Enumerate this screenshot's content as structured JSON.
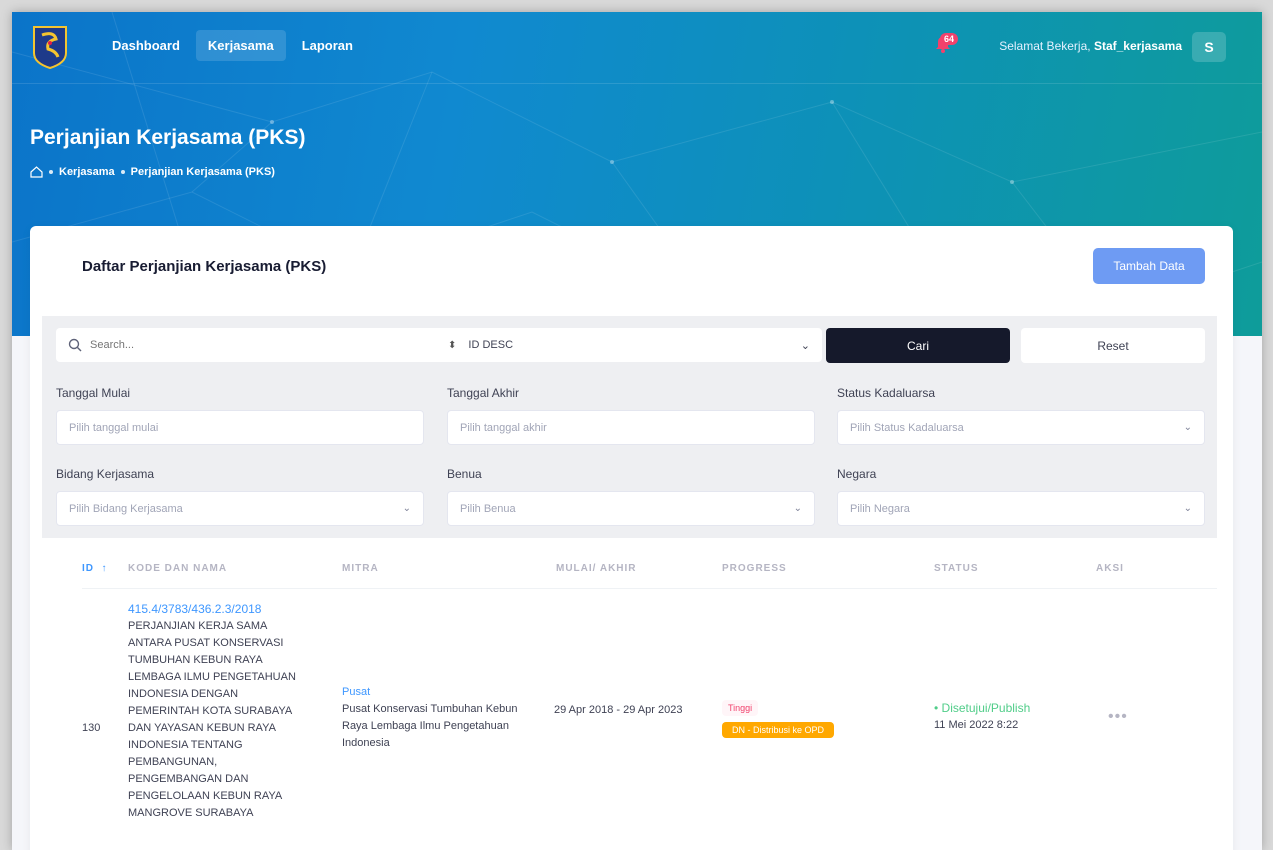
{
  "nav": {
    "items": [
      "Dashboard",
      "Kerjasama",
      "Laporan"
    ],
    "active_index": 1,
    "notification_count": "64",
    "greeting": "Selamat Bekerja,",
    "username": "Staf_kerjasama",
    "avatar_letter": "S"
  },
  "header": {
    "title": "Perjanjian Kerjasama (PKS)",
    "breadcrumb": [
      "Kerjasama",
      "Perjanjian Kerjasama (PKS)"
    ]
  },
  "card": {
    "title": "Daftar Perjanjian Kerjasama (PKS)",
    "add_button": "Tambah Data"
  },
  "filters": {
    "search_placeholder": "Search...",
    "sort_value": "ID DESC",
    "cari_button": "Cari",
    "reset_button": "Reset",
    "tanggal_mulai_label": "Tanggal Mulai",
    "tanggal_mulai_placeholder": "Pilih tanggal mulai",
    "tanggal_akhir_label": "Tanggal Akhir",
    "tanggal_akhir_placeholder": "Pilih tanggal akhir",
    "status_label": "Status Kadaluarsa",
    "status_placeholder": "Pilih Status Kadaluarsa",
    "bidang_label": "Bidang Kerjasama",
    "bidang_placeholder": "Pilih Bidang Kerjasama",
    "benua_label": "Benua",
    "benua_placeholder": "Pilih Benua",
    "negara_label": "Negara",
    "negara_placeholder": "Pilih Negara"
  },
  "table": {
    "columns": {
      "id": "ID",
      "kode": "KODE DAN NAMA",
      "mitra": "MITRA",
      "mulai": "MULAI/ AKHIR",
      "progress": "PROGRESS",
      "status": "STATUS",
      "aksi": "AKSI"
    },
    "rows": [
      {
        "id": "130",
        "kode": "415.4/3783/436.2.3/2018",
        "nama": "PERJANJIAN KERJA SAMA ANTARA PUSAT KONSERVASI TUMBUHAN KEBUN RAYA LEMBAGA ILMU PENGETAHUAN INDONESIA DENGAN PEMERINTAH KOTA SURABAYA DAN YAYASAN KEBUN RAYA INDONESIA TENTANG PEMBANGUNAN, PENGEMBANGAN DAN PENGELOLAAN KEBUN RAYA MANGROVE SURABAYA",
        "mitra_type": "Pusat",
        "mitra_name": "Pusat Konservasi Tumbuhan Kebun Raya Lembaga Ilmu Pengetahuan Indonesia",
        "periode": "29 Apr 2018 - 29 Apr 2023",
        "progress_level": "Tinggi",
        "progress_stage": "DN - Distribusi ke OPD",
        "status": "Disetujui/Publish",
        "status_date": "11 Mei 2022 8:22",
        "aksi": "•••"
      }
    ]
  },
  "colors": {
    "primary": "#3e97ff",
    "success": "#50cd89",
    "danger": "#f1416c",
    "warning": "#ffa800",
    "dark_button": "#15192b",
    "add_button": "#6e9bf3"
  }
}
